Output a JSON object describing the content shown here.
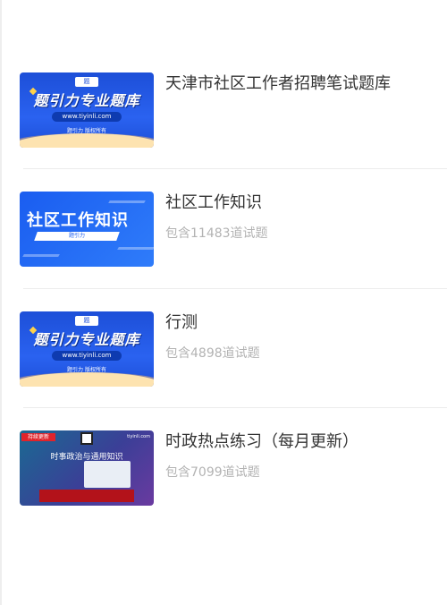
{
  "items": [
    {
      "title": "天津市社区工作者招聘笔试题库",
      "subtitle": "",
      "thumbnail": {
        "style": "promo-blue",
        "headline": "题引力专业题库",
        "url": "www.tiyinli.com",
        "footer": "题引力 版权所有"
      }
    },
    {
      "title": "社区工作知识",
      "subtitle": "包含11483道试题",
      "thumbnail": {
        "style": "social-work",
        "headline": "社区工作知识",
        "sub": "题引力"
      }
    },
    {
      "title": "行测",
      "subtitle": "包含4898道试题",
      "thumbnail": {
        "style": "promo-blue",
        "headline": "题引力专业题库",
        "url": "www.tiyinli.com",
        "footer": "题引力 版权所有"
      }
    },
    {
      "title": "时政热点练习（每月更新）",
      "subtitle": "包含7099道试题",
      "thumbnail": {
        "style": "news",
        "tag": "持续更新",
        "site": "tiyinli.com",
        "headline": "时事政治与通用知识"
      }
    }
  ],
  "colors": {
    "title": "#333333",
    "subtitle": "#b3b3b3",
    "divider": "#ececec",
    "brand_blue": "#1d4fd8"
  }
}
